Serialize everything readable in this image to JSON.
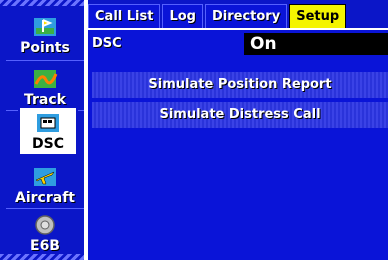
{
  "sidebar": {
    "items": [
      {
        "label": "Points",
        "icon": "points-icon"
      },
      {
        "label": "Track",
        "icon": "track-icon"
      },
      {
        "label": "DSC",
        "icon": "dsc-icon",
        "selected": true
      },
      {
        "label": "Aircraft",
        "icon": "aircraft-icon"
      },
      {
        "label": "E6B",
        "icon": "e6b-icon"
      }
    ]
  },
  "tabs": [
    {
      "label": "Call List"
    },
    {
      "label": "Log"
    },
    {
      "label": "Directory"
    },
    {
      "label": "Setup",
      "active": true
    }
  ],
  "dsc": {
    "label": "DSC",
    "value": "On"
  },
  "buttons": {
    "simulate_position": "Simulate Position Report",
    "simulate_distress": "Simulate Distress Call"
  },
  "colors": {
    "background": "#0a14d8",
    "active_tab": "#f4f400",
    "field_bg": "#000000"
  }
}
